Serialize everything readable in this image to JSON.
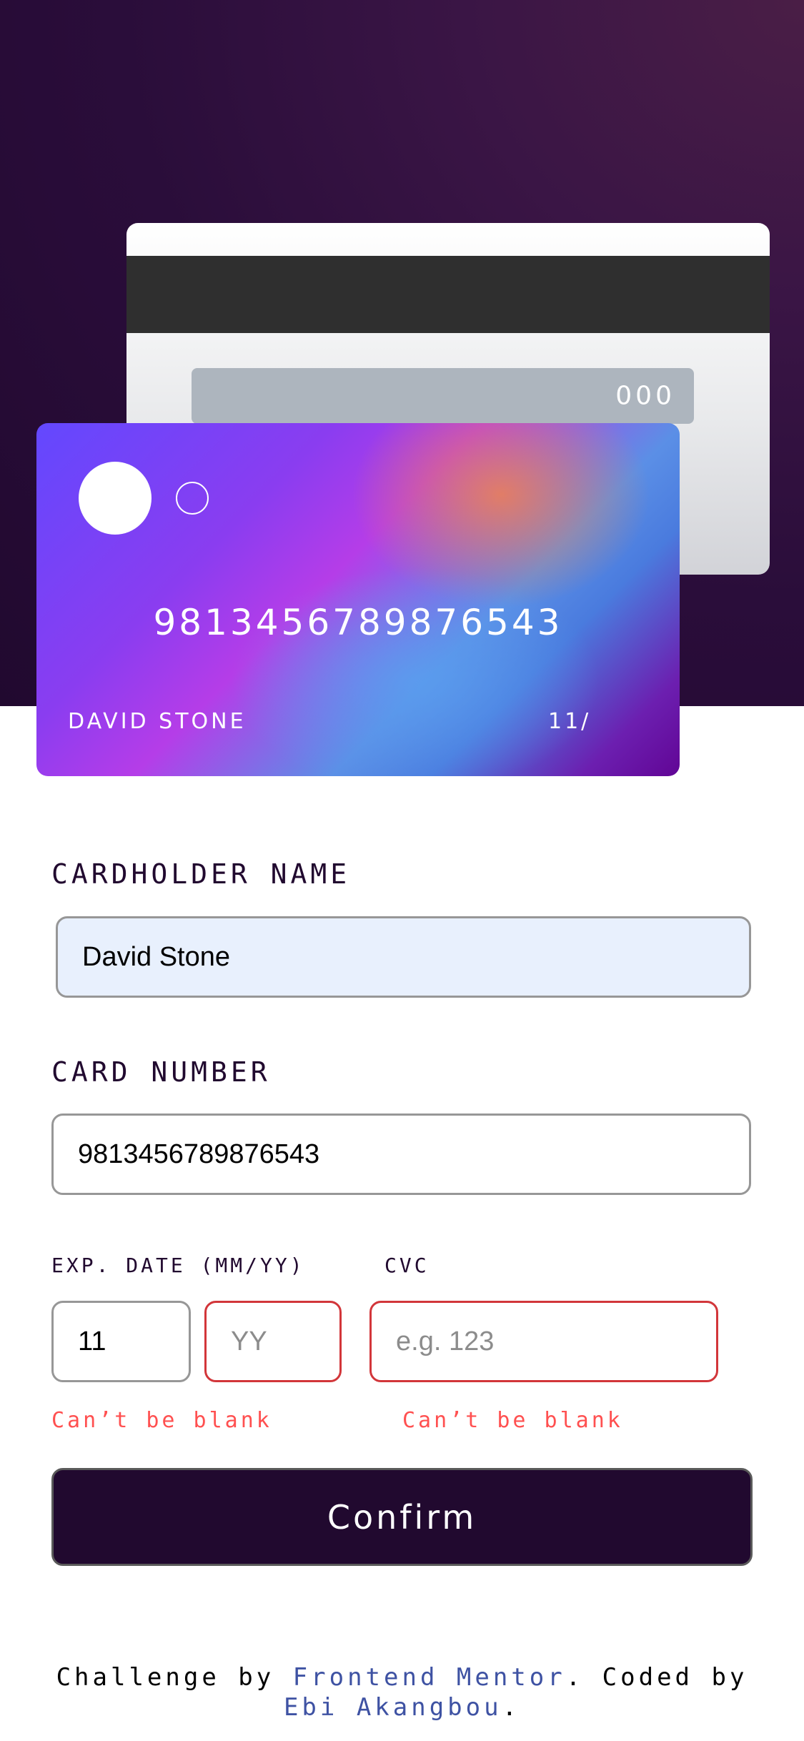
{
  "card_back": {
    "cvc": "000"
  },
  "card_front": {
    "number": "9813456789876543",
    "holder": "DAVID STONE",
    "exp": "11/"
  },
  "form": {
    "name_label": "CARDHOLDER NAME",
    "name_value": "David Stone",
    "number_label": "CARD NUMBER",
    "number_value": "9813456789876543",
    "exp_label": "EXP. DATE (MM/YY)",
    "cvc_label": "CVC",
    "month_value": "11",
    "year_placeholder": "YY",
    "cvc_placeholder": "e.g. 123",
    "exp_error": "Can’t be blank",
    "cvc_error": "Can’t be blank",
    "confirm_label": "Confirm"
  },
  "footer": {
    "prefix": "Challenge by ",
    "link1": "Frontend Mentor",
    "middle": ". Coded by ",
    "link2": "Ebi Akangbou",
    "suffix": "."
  },
  "colors": {
    "dark_violet": "#21092f",
    "error_red": "#ff5050",
    "link_blue": "#3e52a3"
  }
}
